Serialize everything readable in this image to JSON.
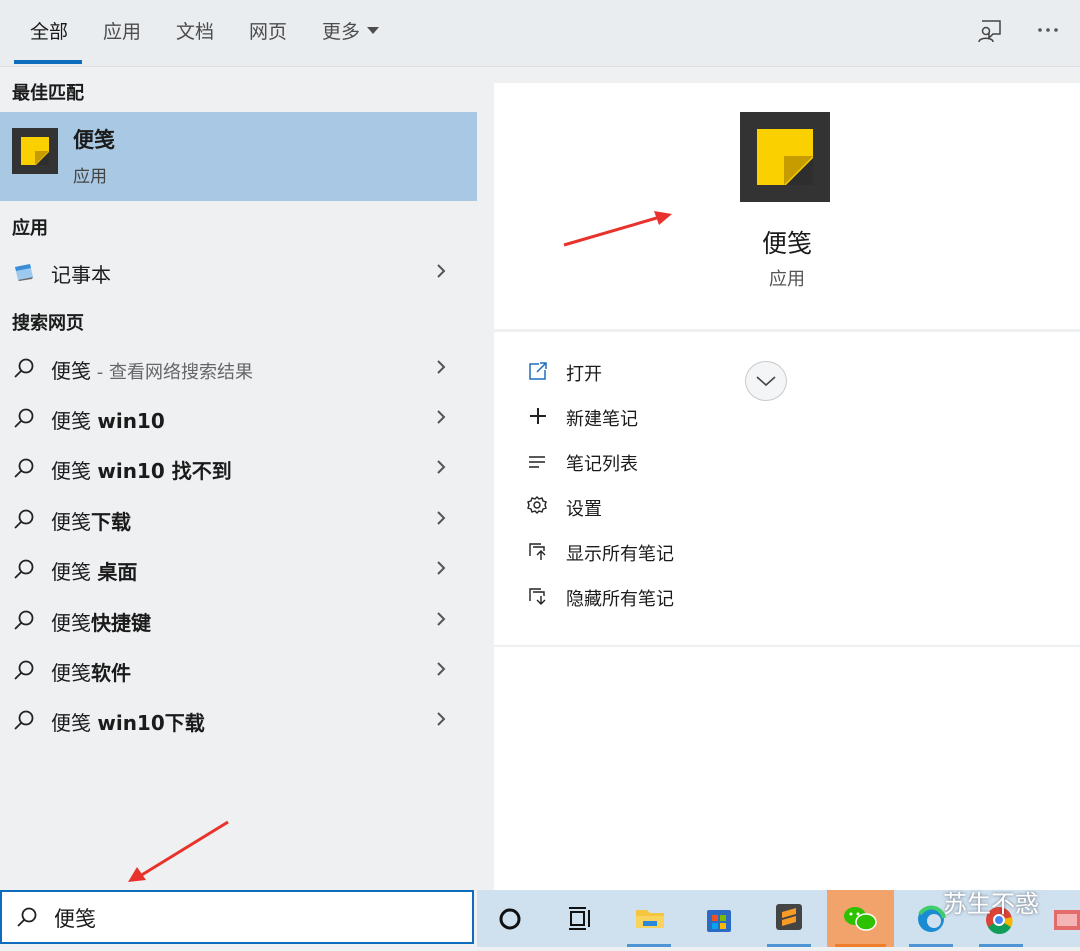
{
  "tabs": [
    {
      "label": "全部",
      "active": true
    },
    {
      "label": "应用",
      "active": false
    },
    {
      "label": "文档",
      "active": false
    },
    {
      "label": "网页",
      "active": false
    },
    {
      "label": "更多",
      "active": false
    }
  ],
  "top_icons": [
    "feedback-icon",
    "more-options-icon"
  ],
  "left": {
    "best_match_heading": "最佳匹配",
    "best_match": {
      "title": "便笺",
      "subtitle": "应用"
    },
    "apps_heading": "应用",
    "apps": [
      {
        "label": "记事本",
        "icon": "notepad-icon"
      }
    ],
    "web_heading": "搜索网页",
    "web_results": [
      {
        "prefix": "便笺",
        "bold": "",
        "suffix": " - 查看网络搜索结果"
      },
      {
        "prefix": "便笺 ",
        "bold": "win10",
        "suffix": ""
      },
      {
        "prefix": "便笺 ",
        "bold": "win10 找不到",
        "suffix": ""
      },
      {
        "prefix": "便笺",
        "bold": "下载",
        "suffix": ""
      },
      {
        "prefix": "便笺 ",
        "bold": "桌面",
        "suffix": ""
      },
      {
        "prefix": "便笺",
        "bold": "快捷键",
        "suffix": ""
      },
      {
        "prefix": "便笺",
        "bold": "软件",
        "suffix": ""
      },
      {
        "prefix": "便笺 ",
        "bold": "win10下载",
        "suffix": ""
      }
    ]
  },
  "search": {
    "value": "便笺"
  },
  "detail": {
    "title": "便笺",
    "subtitle": "应用",
    "actions": [
      {
        "label": "打开",
        "icon": "open-icon"
      },
      {
        "label": "新建笔记",
        "icon": "plus-icon"
      },
      {
        "label": "笔记列表",
        "icon": "list-icon"
      },
      {
        "label": "设置",
        "icon": "gear-icon"
      },
      {
        "label": "显示所有笔记",
        "icon": "show-notes-icon"
      },
      {
        "label": "隐藏所有笔记",
        "icon": "hide-notes-icon"
      }
    ]
  },
  "taskbar": [
    "cortana-icon",
    "task-view-icon",
    "file-explorer-icon",
    "store-icon",
    "sublime-icon",
    "wechat-icon",
    "edge-icon",
    "chrome-icon",
    "app-icon"
  ],
  "watermark": "苏生不惑",
  "colors": {
    "accent": "#0f6cbd",
    "selected": "#a8c8e3",
    "annotation_arrow": "#e8322b",
    "sticky_yellow": "#fbd000"
  }
}
